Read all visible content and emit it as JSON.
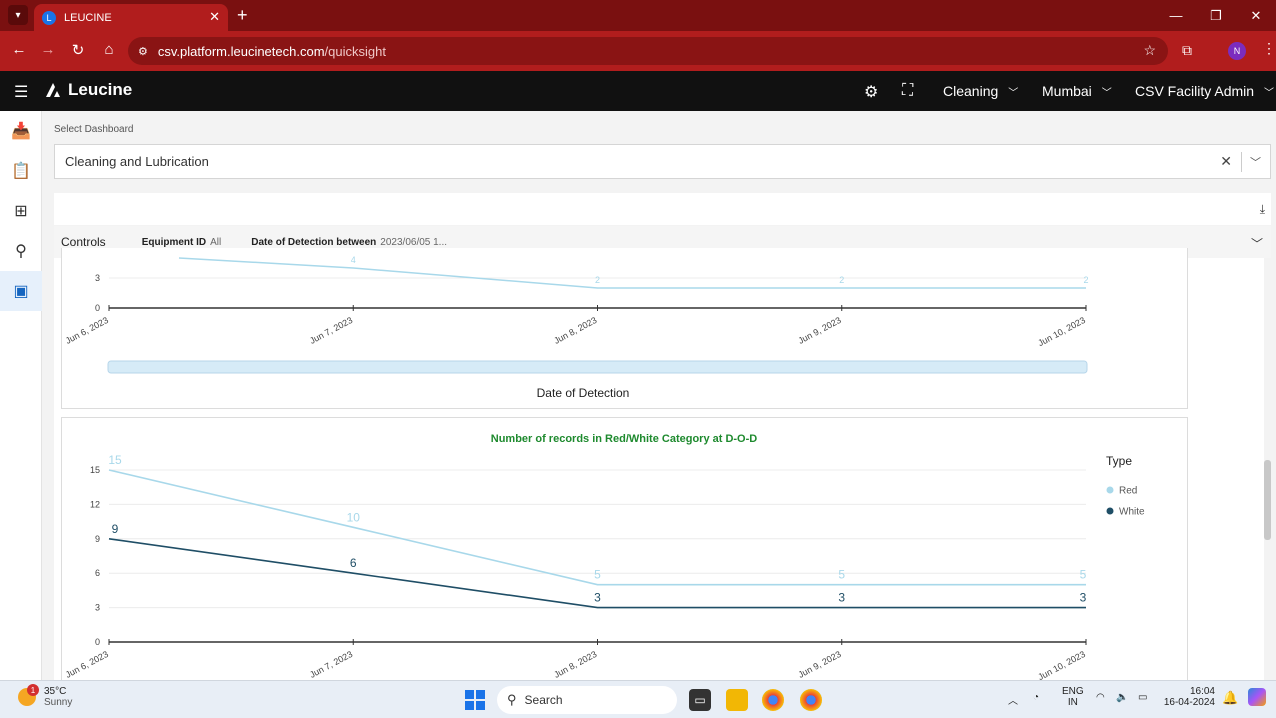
{
  "browser": {
    "tab_title": "LEUCINE",
    "url_domain": "csv.platform.leucinetech.com",
    "url_path": "/quicksight",
    "profile_initial": "N"
  },
  "app": {
    "brand": "Leucine",
    "header_dropdowns": [
      "Cleaning",
      "Mumbai",
      "CSV Facility Admin"
    ]
  },
  "dashboard": {
    "select_label": "Select Dashboard",
    "selected": "Cleaning and Lubrication"
  },
  "controls": {
    "title": "Controls",
    "filter1_label": "Equipment ID",
    "filter1_value": "All",
    "filter2_label": "Date of Detection between",
    "filter2_value": "2023/06/05 1..."
  },
  "colors": {
    "red_series": "#a8d8ea",
    "white_series": "#1f4e66",
    "title_green": "#1e8a2e",
    "slider": "#d6ebf7"
  },
  "chart_data": [
    {
      "type": "line",
      "partial": true,
      "x": [
        "Jun 6, 2023",
        "Jun 7, 2023",
        "Jun 8, 2023",
        "Jun 9, 2023",
        "Jun 10, 2023"
      ],
      "visible_yticks": [
        0,
        3
      ],
      "series": [
        {
          "values": [
            null,
            4,
            2,
            2,
            2
          ],
          "labels": [
            "",
            "4",
            "2",
            "2",
            "2"
          ]
        }
      ],
      "xlabel": "Date of Detection"
    },
    {
      "type": "line",
      "title": "Number of records in Red/White Category at D-O-D",
      "x": [
        "Jun 6, 2023",
        "Jun 7, 2023",
        "Jun 8, 2023",
        "Jun 9, 2023",
        "Jun 10, 2023"
      ],
      "yticks": [
        0,
        3,
        6,
        9,
        12,
        15
      ],
      "ylim": [
        0,
        15
      ],
      "legend_title": "Type",
      "legend_position": "right",
      "series": [
        {
          "name": "Red",
          "values": [
            15,
            10,
            5,
            5,
            5
          ]
        },
        {
          "name": "White",
          "values": [
            9,
            6,
            3,
            3,
            3
          ]
        }
      ]
    }
  ],
  "taskbar": {
    "weather_temp": "35°C",
    "weather_desc": "Sunny",
    "weather_badge": "1",
    "search_placeholder": "Search",
    "lang1": "ENG",
    "lang2": "IN",
    "time": "16:04",
    "date": "16-04-2024"
  }
}
